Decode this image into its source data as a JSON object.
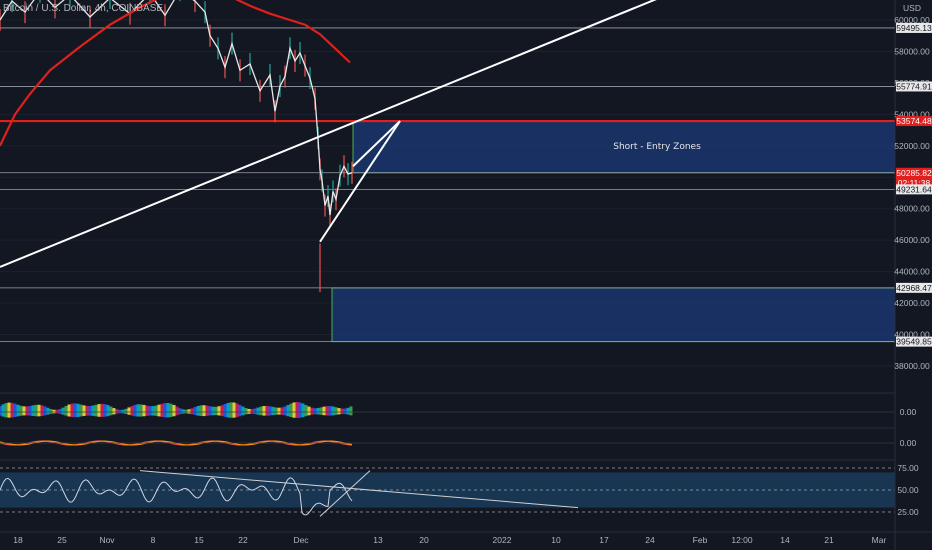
{
  "header": {
    "symbol_title": "Bitcoin / U.S. Dollar, 4h, COINBASE",
    "currency": "USD"
  },
  "annotations": {
    "zone_label": "Short - Entry Zones"
  },
  "colors": {
    "background": "#131722",
    "ma_line": "#e0201a",
    "trendline": "#ffffff",
    "zone_fill": "#1c3a7a",
    "zone_border_green": "#4caf50",
    "zone_border_orange": "#ff9800",
    "osc_band": "#1e4f7a",
    "price_tag_bg": "#e8e8e8",
    "current_price_bg": "#e01f1f"
  },
  "chart_data": [
    {
      "type": "line",
      "series": [
        {
          "role": "price",
          "x": [
            0,
            12,
            25,
            40,
            55,
            70,
            90,
            110,
            130,
            150,
            165,
            180,
            195,
            205,
            210,
            218,
            225,
            232,
            240,
            250,
            260,
            270,
            275,
            280,
            285,
            290,
            295,
            300,
            305,
            310,
            315,
            318,
            320,
            322,
            325,
            328,
            330,
            333,
            336,
            340,
            344,
            348,
            352
          ],
          "values": [
            60000,
            61200,
            60500,
            61800,
            60800,
            61600,
            60200,
            61400,
            60400,
            61700,
            60300,
            61900,
            61200,
            60500,
            59000,
            58200,
            57000,
            58500,
            56800,
            57200,
            55500,
            56500,
            54200,
            55800,
            56400,
            58200,
            57400,
            57900,
            57100,
            56300,
            55000,
            52500,
            50500,
            49800,
            48200,
            48800,
            47600,
            49100,
            48600,
            50100,
            50700,
            50200,
            50285
          ]
        },
        {
          "role": "moving-average",
          "x": [
            0,
            15,
            30,
            50,
            80,
            110,
            140,
            165,
            185,
            200,
            215,
            230,
            250,
            270,
            290,
            305,
            320,
            335,
            350
          ],
          "values": [
            52000,
            54000,
            55300,
            56800,
            58300,
            59700,
            60800,
            61600,
            62000,
            62200,
            62000,
            61500,
            60900,
            60400,
            60000,
            59700,
            59100,
            58200,
            57300
          ]
        }
      ],
      "trendlines": [
        {
          "name": "lower-long",
          "x": [
            0,
            713
          ],
          "values": [
            44300,
            62800
          ]
        },
        {
          "name": "upper-wedge",
          "x": [
            320,
            400
          ],
          "values": [
            45900,
            53574
          ]
        },
        {
          "name": "sma-break",
          "x": [
            353,
            400
          ],
          "values": [
            50700,
            53574
          ]
        }
      ],
      "zones": [
        {
          "name": "short-zone-upper",
          "x0": 353,
          "x1": 895,
          "y_top": 53574.48,
          "y_bottom": 50285.82,
          "label": "Short - Entry Zones"
        },
        {
          "name": "short-zone-lower",
          "x0": 332,
          "x1": 895,
          "y_top": 42968.47,
          "y_bottom": 39549.85,
          "label": ""
        }
      ],
      "horizontal_levels": [
        59495.13,
        55774.91,
        53574.48,
        50285.82,
        49231.64,
        42968.47,
        39549.85
      ],
      "price_labels": [
        {
          "value": "59495.13",
          "style": "light"
        },
        {
          "value": "55774.91",
          "style": "light"
        },
        {
          "value": "53574.48",
          "style": "red"
        },
        {
          "value": "50285.82",
          "style": "red",
          "sub": "02:11:38"
        },
        {
          "value": "49231.64",
          "style": "light"
        },
        {
          "value": "42968.47",
          "style": "light"
        },
        {
          "value": "39549.85",
          "style": "light"
        }
      ],
      "y_ticks": [
        "60000.00",
        "58000.00",
        "56000.00",
        "54000.00",
        "52000.00",
        "48000.00",
        "46000.00",
        "44000.00",
        "42000.00",
        "40000.00",
        "38000.00"
      ],
      "x_ticks": [
        "18",
        "25",
        "Nov",
        "8",
        "15",
        "22",
        "Dec",
        "13",
        "20",
        "2022",
        "10",
        "17",
        "24",
        "Feb",
        "12:00",
        "14",
        "21",
        "Mar"
      ],
      "ylabel": "USD"
    },
    {
      "type": "area",
      "role": "oscillator-1",
      "y_ticks": [
        "0.00"
      ]
    },
    {
      "type": "line",
      "role": "oscillator-2",
      "y_ticks": [
        "0.00"
      ]
    },
    {
      "type": "line",
      "role": "rsi",
      "y_ticks": [
        "75.00",
        "50.00",
        "25.00"
      ],
      "band": [
        30,
        70
      ],
      "trendline_down": {
        "x": [
          140,
          578
        ],
        "values": [
          72,
          30
        ]
      },
      "trendline_up": {
        "x": [
          320,
          370
        ],
        "values": [
          20,
          72
        ]
      }
    }
  ]
}
